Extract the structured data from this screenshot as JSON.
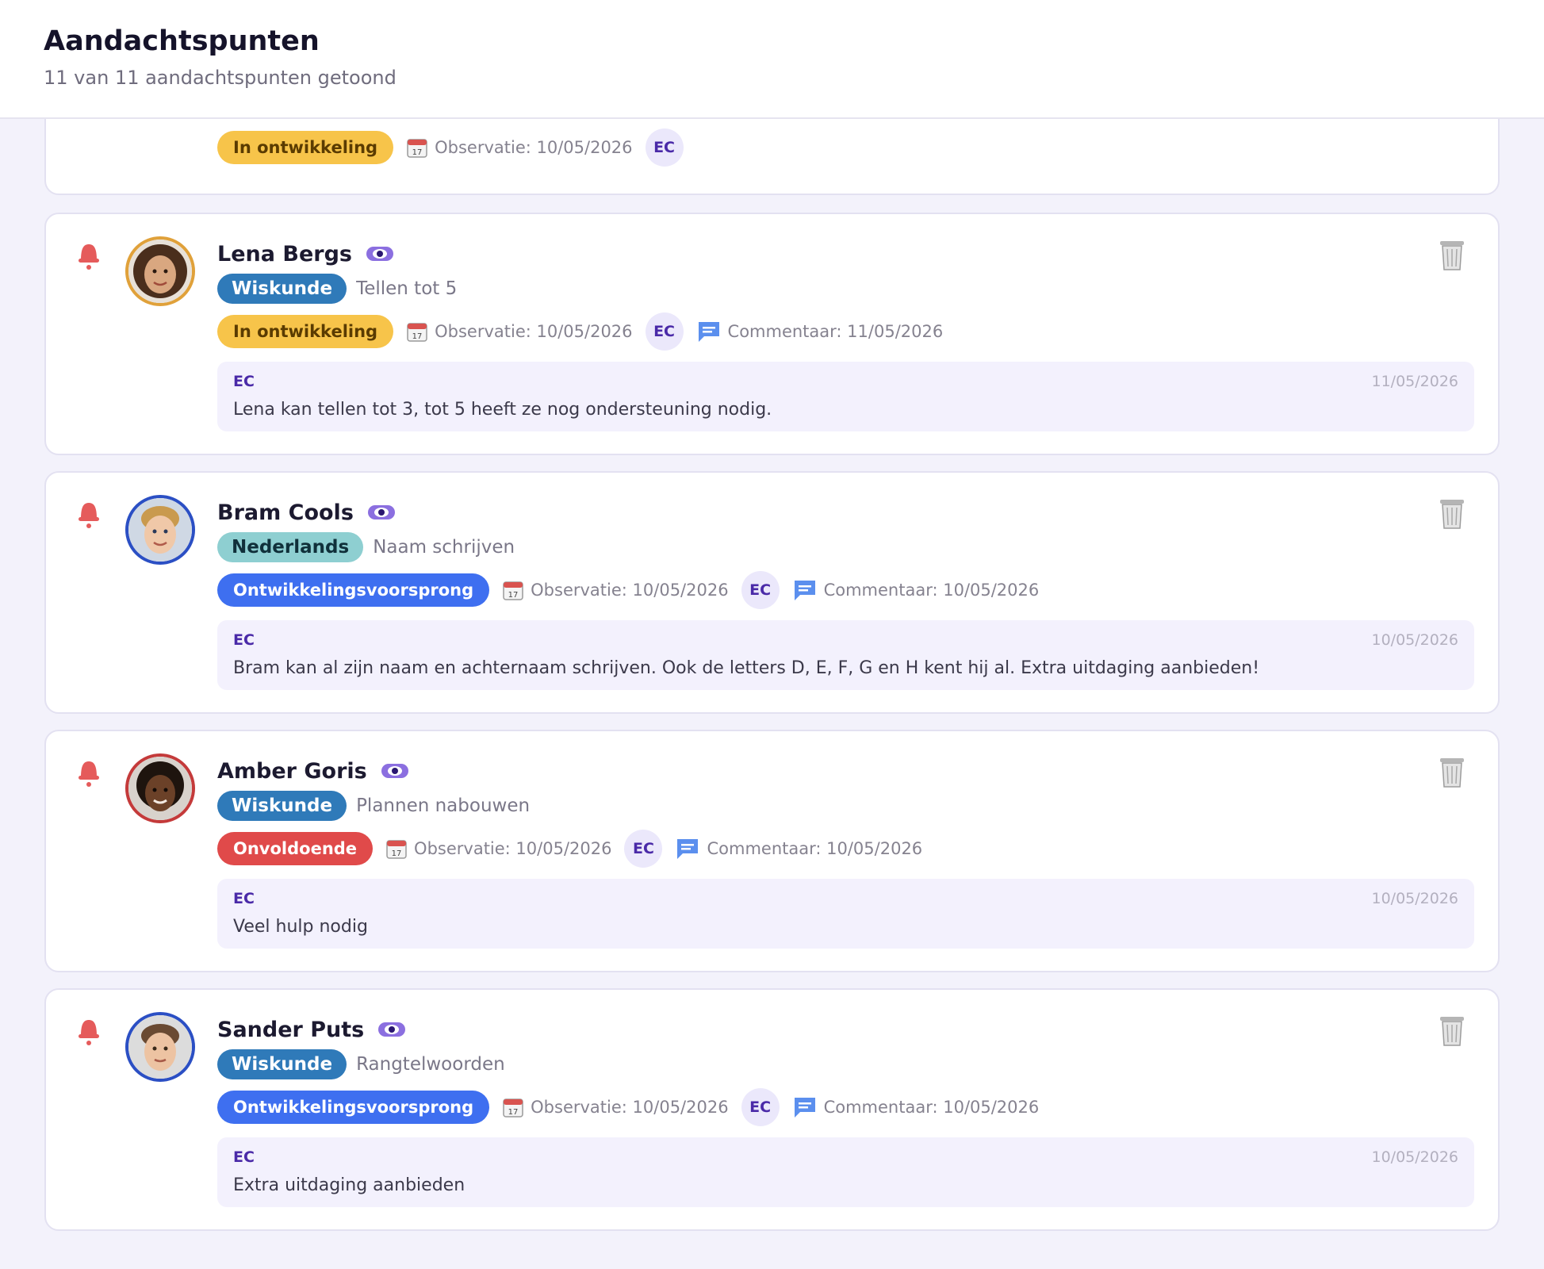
{
  "header": {
    "title": "Aandachtspunten",
    "subtitle": "11 van 11 aandachtspunten getoond"
  },
  "partial_card": {
    "status": "In ontwikkeling",
    "observation": "Observatie: 10/05/2026",
    "initials": "EC"
  },
  "cards": [
    {
      "name": "Lena Bergs",
      "subject": "Wiskunde",
      "topic": "Tellen tot 5",
      "status": "In ontwikkeling",
      "observation": "Observatie: 10/05/2026",
      "initials": "EC",
      "comment_meta": "Commentaar: 11/05/2026",
      "comment": {
        "author": "EC",
        "date": "11/05/2026",
        "text": "Lena kan tellen tot 3, tot 5 heeft ze nog ondersteuning nodig."
      }
    },
    {
      "name": "Bram Cools",
      "subject": "Nederlands",
      "topic": "Naam schrijven",
      "status": "Ontwikkelingsvoorsprong",
      "observation": "Observatie: 10/05/2026",
      "initials": "EC",
      "comment_meta": "Commentaar: 10/05/2026",
      "comment": {
        "author": "EC",
        "date": "10/05/2026",
        "text": "Bram kan al zijn naam en achternaam schrijven. Ook de letters D, E, F, G en H kent hij al. Extra uitdaging aanbieden!"
      }
    },
    {
      "name": "Amber Goris",
      "subject": "Wiskunde",
      "topic": "Plannen nabouwen",
      "status": "Onvoldoende",
      "observation": "Observatie: 10/05/2026",
      "initials": "EC",
      "comment_meta": "Commentaar: 10/05/2026",
      "comment": {
        "author": "EC",
        "date": "10/05/2026",
        "text": "Veel hulp nodig"
      }
    },
    {
      "name": "Sander Puts",
      "subject": "Wiskunde",
      "topic": "Rangtelwoorden",
      "status": "Ontwikkelingsvoorsprong",
      "observation": "Observatie: 10/05/2026",
      "initials": "EC",
      "comment_meta": "Commentaar: 10/05/2026",
      "comment": {
        "author": "EC",
        "date": "10/05/2026",
        "text": "Extra uitdaging aanbieden"
      }
    }
  ],
  "colors": {
    "accent": "#4a2aa8",
    "bell": "#e55b5b",
    "status_in_progress": "#f7c44a",
    "status_ahead": "#3e6ff0",
    "status_insufficient": "#e04a4a",
    "subject_math": "#2f7ab9",
    "subject_dutch": "#8ecfd1"
  },
  "icons": [
    "bell-icon",
    "eye-icon",
    "calendar-icon",
    "chat-icon",
    "trash-icon"
  ]
}
